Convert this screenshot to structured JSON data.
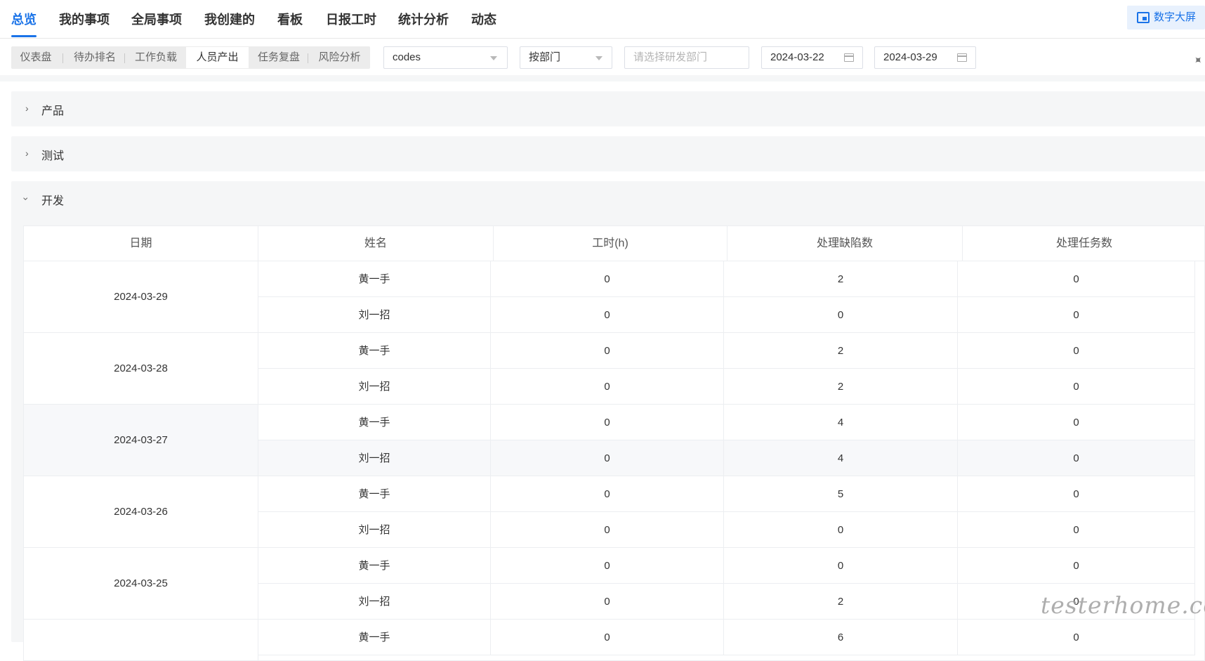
{
  "nav": {
    "tabs": [
      "总览",
      "我的事项",
      "全局事项",
      "我创建的",
      "看板",
      "日报工时",
      "统计分析",
      "动态"
    ],
    "active_index": 0,
    "big_screen_label": "数字大屏"
  },
  "filters": {
    "subtabs": [
      "仪表盘",
      "待办排名",
      "工作负载",
      "人员产出",
      "任务复盘",
      "风险分析"
    ],
    "active_subtab_index": 3,
    "project_value": "codes",
    "group_value": "按部门",
    "department_placeholder": "请选择研发部门",
    "start_date": "2024-03-22",
    "end_date": "2024-03-29"
  },
  "panels": [
    {
      "title": "产品",
      "expanded": false
    },
    {
      "title": "测试",
      "expanded": false
    },
    {
      "title": "开发",
      "expanded": true
    }
  ],
  "table": {
    "columns": [
      "日期",
      "姓名",
      "工时(h)",
      "处理缺陷数",
      "处理任务数"
    ],
    "groups": [
      {
        "date": "2024-03-29",
        "rows": [
          {
            "name": "黄一手",
            "hours": "0",
            "bugs": "2",
            "tasks": "0"
          },
          {
            "name": "刘一招",
            "hours": "0",
            "bugs": "0",
            "tasks": "0"
          }
        ]
      },
      {
        "date": "2024-03-28",
        "rows": [
          {
            "name": "黄一手",
            "hours": "0",
            "bugs": "2",
            "tasks": "0"
          },
          {
            "name": "刘一招",
            "hours": "0",
            "bugs": "2",
            "tasks": "0"
          }
        ]
      },
      {
        "date": "2024-03-27",
        "highlighted": true,
        "rows": [
          {
            "name": "黄一手",
            "hours": "0",
            "bugs": "4",
            "tasks": "0"
          },
          {
            "name": "刘一招",
            "hours": "0",
            "bugs": "4",
            "tasks": "0"
          }
        ]
      },
      {
        "date": "2024-03-26",
        "rows": [
          {
            "name": "黄一手",
            "hours": "0",
            "bugs": "5",
            "tasks": "0"
          },
          {
            "name": "刘一招",
            "hours": "0",
            "bugs": "0",
            "tasks": "0"
          }
        ]
      },
      {
        "date": "2024-03-25",
        "rows": [
          {
            "name": "黄一手",
            "hours": "0",
            "bugs": "0",
            "tasks": "0"
          },
          {
            "name": "刘一招",
            "hours": "0",
            "bugs": "2",
            "tasks": "0"
          }
        ]
      },
      {
        "date": "",
        "rows": [
          {
            "name": "黄一手",
            "hours": "0",
            "bugs": "6",
            "tasks": "0"
          }
        ]
      }
    ]
  },
  "watermark": "testerhome.com"
}
